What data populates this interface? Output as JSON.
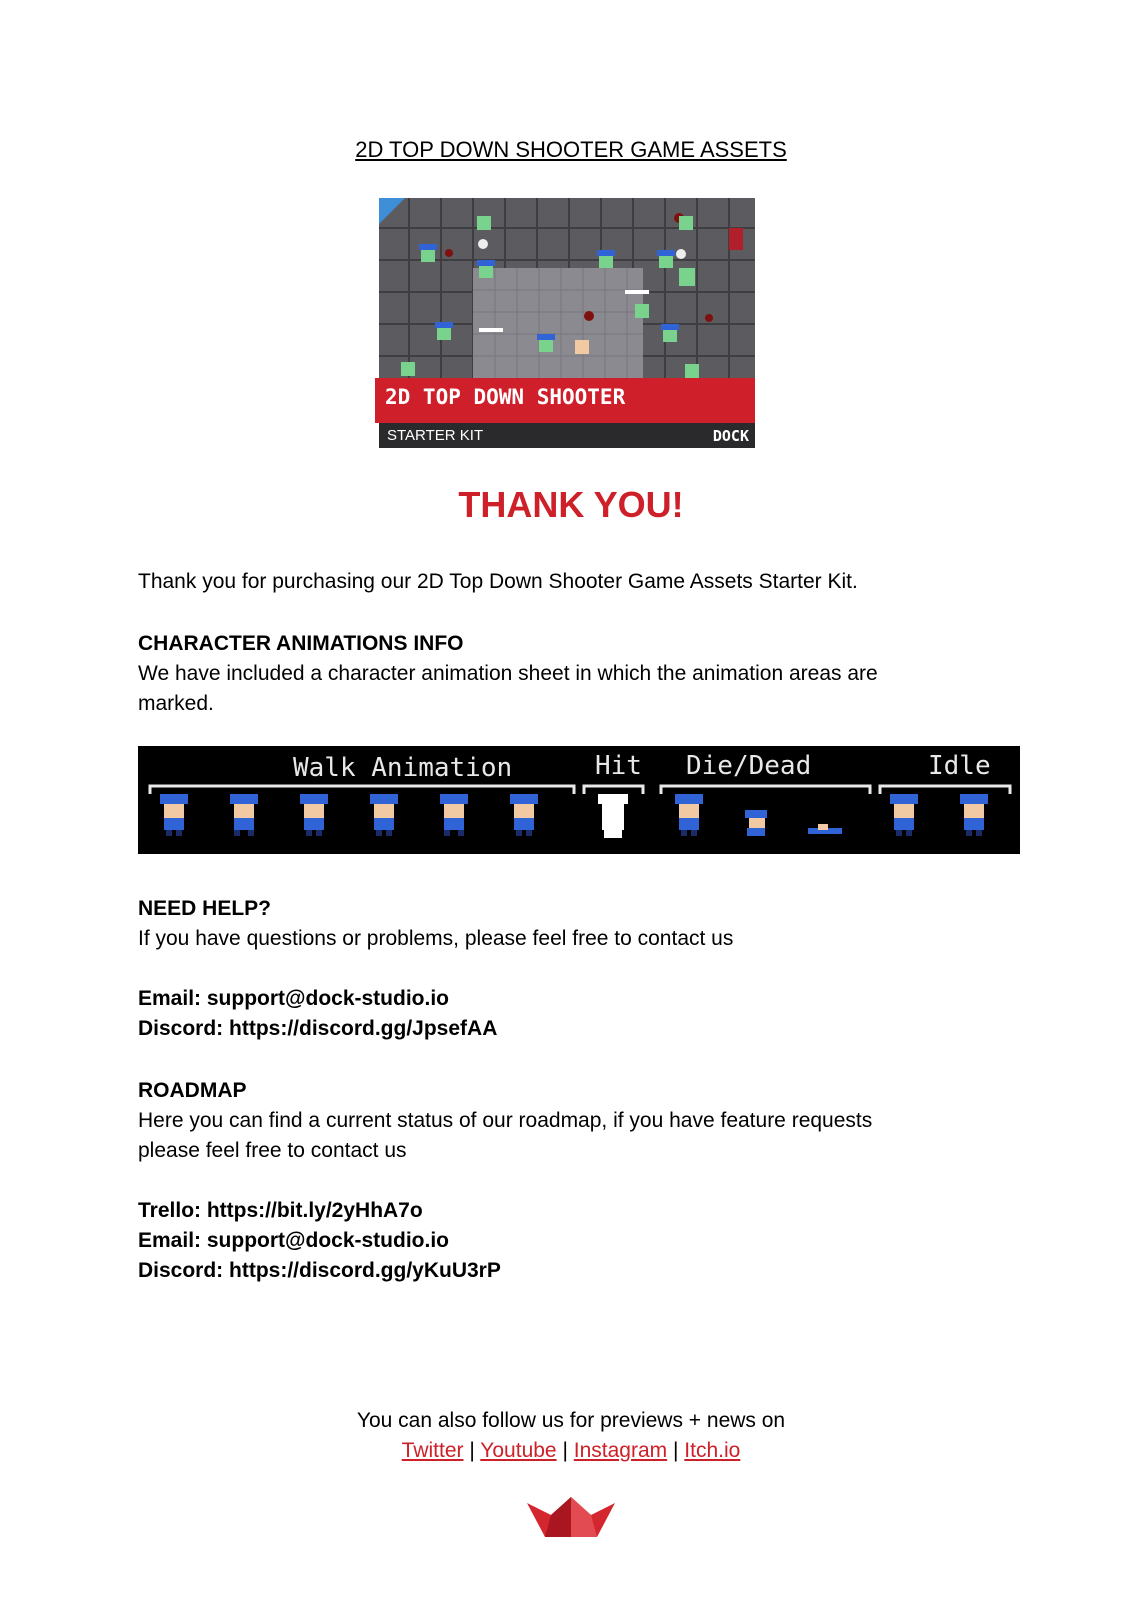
{
  "document": {
    "title": "2D TOP DOWN SHOOTER GAME ASSETS",
    "thank_you": "THANK YOU!",
    "intro": "Thank you for purchasing our 2D Top Down Shooter Game Assets Starter Kit."
  },
  "cover": {
    "badge": "2D",
    "title": "2D TOP DOWN SHOOTER",
    "subtitle": "STARTER KIT",
    "brand": "DOCK"
  },
  "animations": {
    "heading": "CHARACTER ANIMATIONS INFO",
    "text_line1": "We have included a character animation sheet in which the animation areas are",
    "text_line2": "marked.",
    "labels": {
      "walk": "Walk Animation",
      "hit": "Hit",
      "die": "Die/Dead",
      "idle": "Idle"
    }
  },
  "help": {
    "heading": "NEED HELP?",
    "text": "If you have questions or problems, please feel free to contact us",
    "email": "Email: support@dock-studio.io",
    "discord": "Discord: https://discord.gg/JpsefAA"
  },
  "roadmap": {
    "heading": "ROADMAP",
    "text_line1": "Here you can find a current status of our roadmap, if you have feature requests",
    "text_line2": "please feel free to contact us",
    "trello": "Trello: https://bit.ly/2yHhA7o",
    "email": "Email: support@dock-studio.io",
    "discord": "Discord: https://discord.gg/yKuU3rP"
  },
  "footer": {
    "follow": "You can also follow us for previews + news on",
    "links": [
      "Twitter",
      "Youtube",
      "Instagram",
      "Itch.io"
    ],
    "separator": "|"
  },
  "colors": {
    "accent_red": "#cd2028",
    "cover_dark": "#2a2a2d",
    "police_blue": "#2f63d6"
  }
}
